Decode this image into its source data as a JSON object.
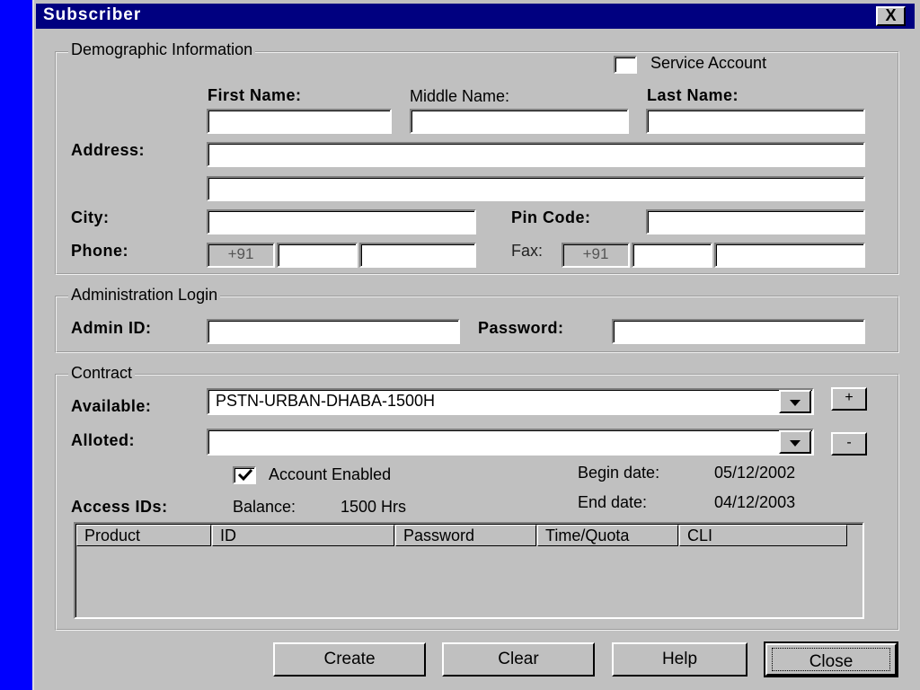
{
  "window": {
    "title": "Subscriber",
    "close_label": "X"
  },
  "demographic": {
    "legend": "Demographic Information",
    "service_account_label": "Service Account",
    "service_account_checked": false,
    "first_name_label": "First Name:",
    "middle_name_label": "Middle Name:",
    "last_name_label": "Last Name:",
    "address_label": "Address:",
    "city_label": "City:",
    "pin_code_label": "Pin Code:",
    "phone_label": "Phone:",
    "fax_label": "Fax:",
    "phone_country_code": "+91",
    "fax_country_code": "+91",
    "first_name": "",
    "middle_name": "",
    "last_name": "",
    "address_line1": "",
    "address_line2": "",
    "city": "",
    "pin_code": ""
  },
  "admin": {
    "legend": "Administration Login",
    "admin_id_label": "Admin ID:",
    "password_label": "Password:",
    "admin_id": "",
    "password": ""
  },
  "contract": {
    "legend": "Contract",
    "available_label": "Available:",
    "available_value": "PSTN-URBAN-DHABA-1500H",
    "alloted_label": "Alloted:",
    "alloted_value": "",
    "add_label": "+",
    "remove_label": "-",
    "account_enabled_label": "Account Enabled",
    "account_enabled_checked": true,
    "begin_date_label": "Begin date:",
    "begin_date": "05/12/2002",
    "end_date_label": "End date:",
    "end_date": "04/12/2003",
    "access_ids_label": "Access IDs:",
    "balance_label": "Balance:",
    "balance_value": "1500 Hrs",
    "columns": [
      "Product",
      "ID",
      "Password",
      "Time/Quota",
      "CLI"
    ]
  },
  "buttons": {
    "create": "Create",
    "clear": "Clear",
    "help": "Help",
    "close": "Close"
  },
  "colors": {
    "titlebar": "#000080",
    "desktop": "#0000ff",
    "face": "#c0c0c0"
  }
}
